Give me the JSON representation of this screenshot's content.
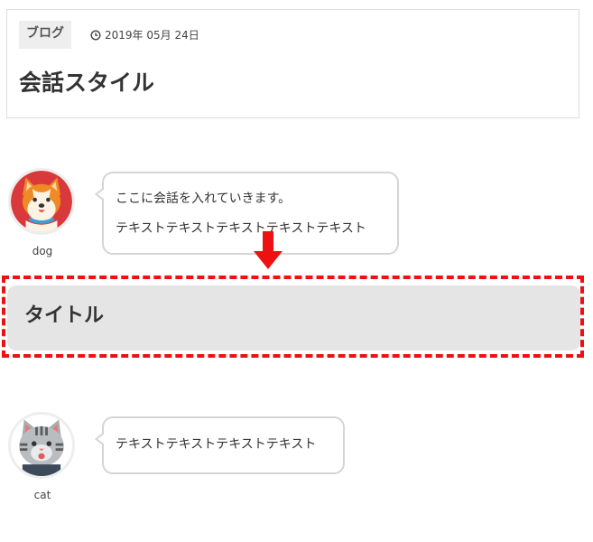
{
  "header": {
    "category": "ブログ",
    "date": "2019年 05月 24日",
    "title": "会話スタイル"
  },
  "conversation": [
    {
      "speaker": "dog",
      "lines": [
        "ここに会話を入れていきます。",
        "テキストテキストテキストテキストテキスト"
      ]
    },
    {
      "speaker": "cat",
      "lines": [
        "テキストテキストテキストテキスト"
      ]
    }
  ],
  "title_box": {
    "text": "タイトル"
  },
  "colors": {
    "dashed_border": "#ee1111",
    "arrow": "#ee1111",
    "title_box_bg": "#e5e5e5"
  },
  "icons": [
    "clock-icon",
    "down-arrow-icon"
  ]
}
